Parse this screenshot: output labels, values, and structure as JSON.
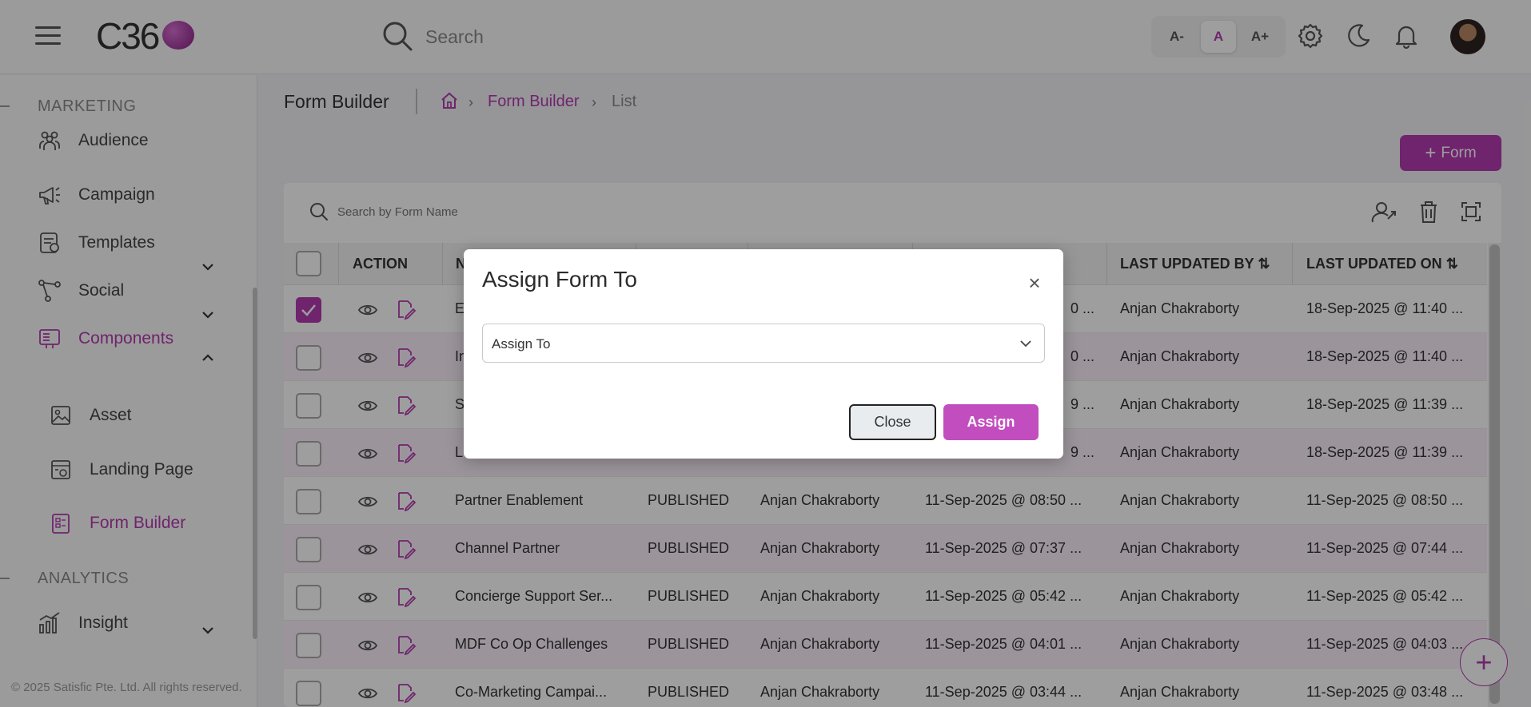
{
  "header": {
    "logo_text": "C36",
    "search_placeholder": "Search",
    "font_sizes": [
      "A-",
      "A",
      "A+"
    ],
    "active_font_size": "A"
  },
  "sidebar": {
    "sections": [
      {
        "label": "MARKETING"
      },
      {
        "label": "ANALYTICS"
      }
    ],
    "items": [
      {
        "label": "Audience",
        "icon": "audience-icon"
      },
      {
        "label": "Campaign",
        "icon": "megaphone-icon"
      },
      {
        "label": "Templates",
        "icon": "templates-icon"
      },
      {
        "label": "Social",
        "icon": "social-icon"
      },
      {
        "label": "Components",
        "icon": "components-icon"
      },
      {
        "label": "Insight",
        "icon": "insight-icon"
      }
    ],
    "sub_items": [
      {
        "label": "Asset",
        "icon": "image-icon"
      },
      {
        "label": "Landing Page",
        "icon": "landing-page-icon"
      },
      {
        "label": "Form Builder",
        "icon": "form-icon"
      }
    ],
    "footer": "© 2025 Satisfic Pte. Ltd. All rights reserved."
  },
  "page": {
    "title": "Form Builder",
    "breadcrumb": [
      "Form Builder",
      "List"
    ],
    "add_button": "Form",
    "search_placeholder": "Search by Form Name"
  },
  "table": {
    "headers": [
      "ACTION",
      "N",
      "LAST UPDATED BY",
      "LAST UPDATED ON"
    ],
    "rows": [
      {
        "name": "E",
        "status": "",
        "created_by": "",
        "created_on": "0 ...",
        "updated_by": "Anjan Chakraborty",
        "updated_on": "18-Sep-2025 @ 11:40 ...",
        "checked": true
      },
      {
        "name": "In",
        "status": "",
        "created_by": "",
        "created_on": "0 ...",
        "updated_by": "Anjan Chakraborty",
        "updated_on": "18-Sep-2025 @ 11:40 ...",
        "checked": false
      },
      {
        "name": "S",
        "status": "",
        "created_by": "",
        "created_on": "9 ...",
        "updated_by": "Anjan Chakraborty",
        "updated_on": "18-Sep-2025 @ 11:39 ...",
        "checked": false
      },
      {
        "name": "L",
        "status": "",
        "created_by": "",
        "created_on": "9 ...",
        "updated_by": "Anjan Chakraborty",
        "updated_on": "18-Sep-2025 @ 11:39 ...",
        "checked": false
      },
      {
        "name": "Partner Enablement",
        "status": "PUBLISHED",
        "created_by": "Anjan Chakraborty",
        "created_on": "11-Sep-2025 @ 08:50 ...",
        "updated_by": "Anjan Chakraborty",
        "updated_on": "11-Sep-2025 @ 08:50 ...",
        "checked": false
      },
      {
        "name": "Channel Partner",
        "status": "PUBLISHED",
        "created_by": "Anjan Chakraborty",
        "created_on": "11-Sep-2025 @ 07:37 ...",
        "updated_by": "Anjan Chakraborty",
        "updated_on": "11-Sep-2025 @ 07:44 ...",
        "checked": false
      },
      {
        "name": "Concierge Support Ser...",
        "status": "PUBLISHED",
        "created_by": "Anjan Chakraborty",
        "created_on": "11-Sep-2025 @ 05:42 ...",
        "updated_by": "Anjan Chakraborty",
        "updated_on": "11-Sep-2025 @ 05:42 ...",
        "checked": false
      },
      {
        "name": "MDF Co Op Challenges",
        "status": "PUBLISHED",
        "created_by": "Anjan Chakraborty",
        "created_on": "11-Sep-2025 @ 04:01 ...",
        "updated_by": "Anjan Chakraborty",
        "updated_on": "11-Sep-2025 @ 04:03 ...",
        "checked": false
      },
      {
        "name": "Co-Marketing Campai...",
        "status": "PUBLISHED",
        "created_by": "Anjan Chakraborty",
        "created_on": "11-Sep-2025 @ 03:44 ...",
        "updated_by": "Anjan Chakraborty",
        "updated_on": "11-Sep-2025 @ 03:48 ...",
        "checked": false
      }
    ]
  },
  "modal": {
    "title": "Assign Form To",
    "select_value": "Assign To",
    "close_label": "Close",
    "assign_label": "Assign"
  },
  "colors": {
    "accent": "#b43bb0",
    "overlay": "rgba(0,0,0,0.38)"
  }
}
